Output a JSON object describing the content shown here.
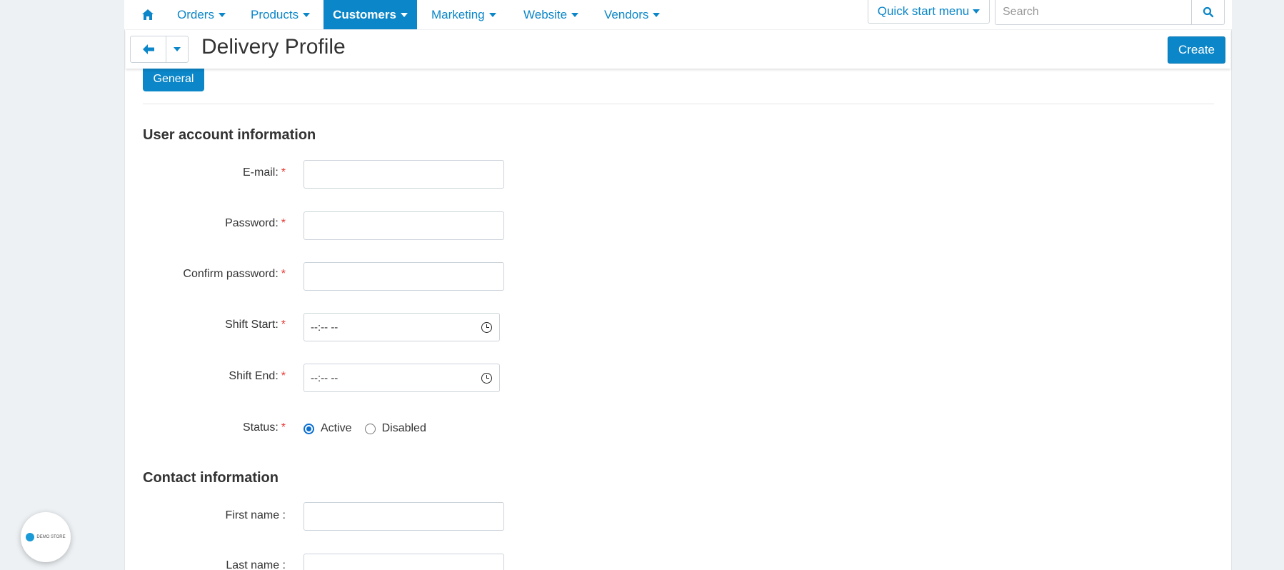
{
  "nav": {
    "items": [
      {
        "label": "Orders"
      },
      {
        "label": "Products"
      },
      {
        "label": "Customers",
        "active": true
      },
      {
        "label": "Marketing"
      },
      {
        "label": "Website"
      },
      {
        "label": "Vendors"
      }
    ],
    "quick_start_label": "Quick start menu",
    "search_placeholder": "Search"
  },
  "titlebar": {
    "title": "Delivery Profile",
    "create_label": "Create"
  },
  "tabs": {
    "general_label": "General"
  },
  "sections": {
    "account_title": "User account information",
    "contact_title": "Contact information"
  },
  "fields": {
    "email_label": "E-mail:",
    "password_label": "Password:",
    "confirm_password_label": "Confirm password:",
    "shift_start_label": "Shift Start:",
    "shift_end_label": "Shift End:",
    "status_label": "Status:",
    "first_name_label": "First name :",
    "last_name_label": "Last name :",
    "required_mark": "*",
    "time_placeholder": "--:-- --"
  },
  "status": {
    "active_label": "Active",
    "disabled_label": "Disabled",
    "selected": "Active"
  },
  "badge": {
    "text": "DEMO STORE"
  },
  "colors": {
    "accent": "#0b86c8",
    "required": "#e53935",
    "background": "#edf1f4"
  }
}
